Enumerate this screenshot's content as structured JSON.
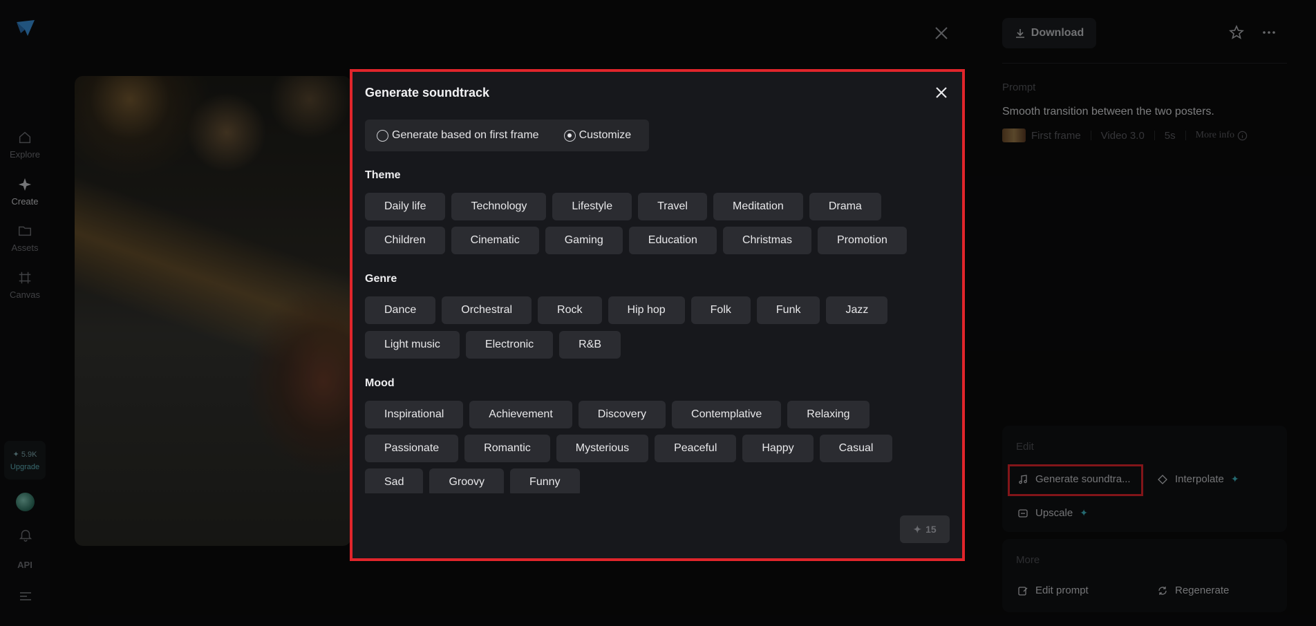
{
  "rail": {
    "items": [
      {
        "label": "Explore",
        "icon": "home-icon"
      },
      {
        "label": "Create",
        "icon": "sparkle-icon"
      },
      {
        "label": "Assets",
        "icon": "folder-icon"
      },
      {
        "label": "Canvas",
        "icon": "canvas-icon"
      }
    ],
    "credits_amount": "✦ 5.9K",
    "credits_upgrade": "Upgrade",
    "api_label": "API"
  },
  "right_panel": {
    "download_label": "Download",
    "prompt_label": "Prompt",
    "prompt_text": "Smooth transition between the two posters.",
    "meta": {
      "frame": "First frame",
      "model": "Video 3.0",
      "duration": "5s",
      "more_info": "More info"
    },
    "edit_label": "Edit",
    "edit_items": {
      "soundtrack": "Generate soundtra...",
      "interpolate": "Interpolate",
      "upscale": "Upscale"
    },
    "more_label": "More",
    "more_items": {
      "edit_prompt": "Edit prompt",
      "regenerate": "Regenerate"
    }
  },
  "modal": {
    "title": "Generate soundtrack",
    "modes": {
      "first_frame": "Generate based on first frame",
      "customize": "Customize",
      "selected": "customize"
    },
    "theme": {
      "title": "Theme",
      "row1": [
        "Daily life",
        "Technology",
        "Lifestyle",
        "Travel",
        "Meditation",
        "Drama"
      ],
      "row2": [
        "Children",
        "Cinematic",
        "Gaming",
        "Education",
        "Christmas",
        "Promotion"
      ]
    },
    "genre": {
      "title": "Genre",
      "row1": [
        "Dance",
        "Orchestral",
        "Rock",
        "Hip hop",
        "Folk",
        "Funk",
        "Jazz"
      ],
      "row2": [
        "Light music",
        "Electronic",
        "R&B"
      ]
    },
    "mood": {
      "title": "Mood",
      "row1": [
        "Inspirational",
        "Achievement",
        "Discovery",
        "Contemplative",
        "Relaxing"
      ],
      "row2": [
        "Passionate",
        "Romantic",
        "Mysterious",
        "Peaceful",
        "Happy",
        "Casual"
      ],
      "row3": [
        "Sad",
        "Groovy",
        "Funny"
      ]
    },
    "generate_cost": "15"
  },
  "colors": {
    "accent_highlight": "#e0252b",
    "spark": "#3fb5c2",
    "modal_bg": "#17181c",
    "chip_bg": "#2b2c31"
  }
}
